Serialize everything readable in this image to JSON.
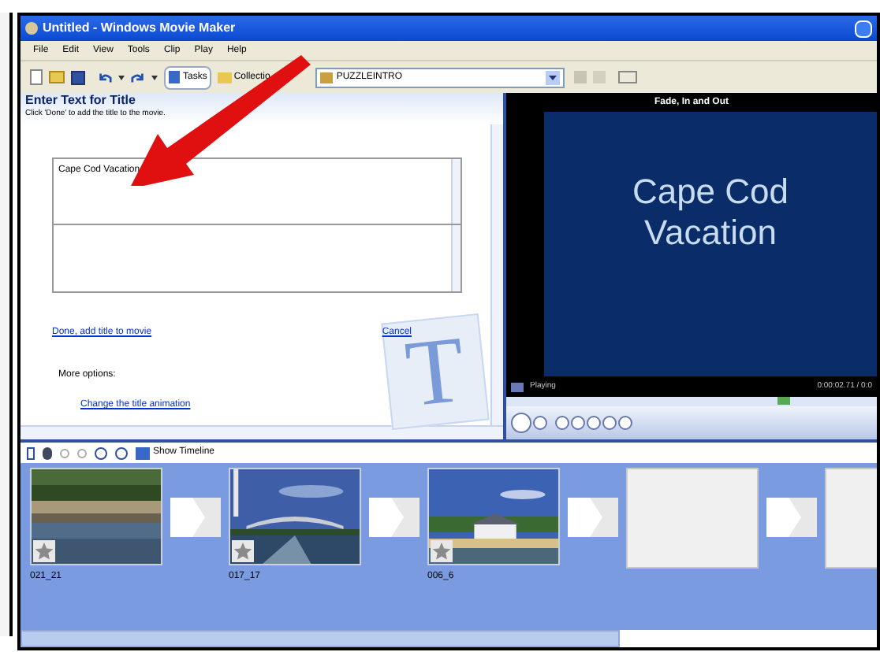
{
  "window": {
    "title": "Untitled - Windows Movie Maker"
  },
  "menu": [
    "File",
    "Edit",
    "View",
    "Tools",
    "Clip",
    "Play",
    "Help"
  ],
  "toolbar": {
    "tasks_label": "Tasks",
    "collections_label": "Collectio",
    "collection_name": "PUZZLEINTRO"
  },
  "title_panel": {
    "heading": "Enter Text for Title",
    "hint": "Click 'Done' to add the title to the movie.",
    "title_text": "Cape Cod Vacation",
    "done_link": "Done, add title to movie",
    "cancel_link": "Cancel",
    "more_options": "More options:",
    "animation_link": "Change the title animation",
    "watermark_letter": "T"
  },
  "preview": {
    "caption": "Fade, In and Out",
    "screen_text": "Cape Cod Vacation",
    "status": "Playing",
    "time": "0:00:02.71 / 0:0",
    "level": 0.75
  },
  "storyboard": {
    "show_timeline_label": "Show Timeline",
    "items": [
      {
        "kind": "clip",
        "name": "021_21"
      },
      {
        "kind": "clip",
        "name": "017_17"
      },
      {
        "kind": "clip",
        "name": "006_6"
      },
      {
        "kind": "empty"
      },
      {
        "kind": "empty"
      }
    ]
  }
}
